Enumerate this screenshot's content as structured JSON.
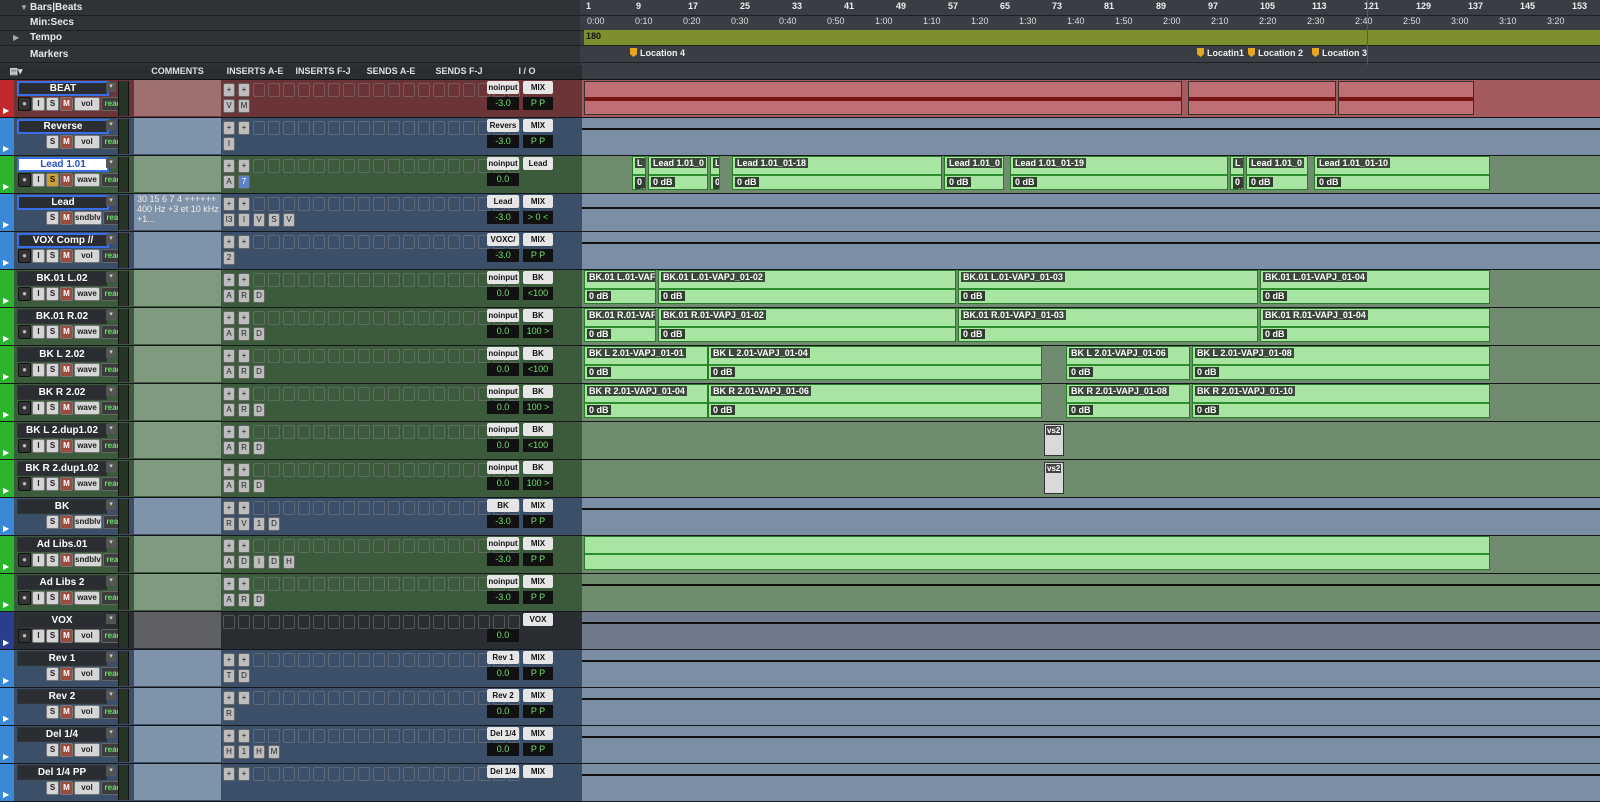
{
  "rulers": {
    "bars_beats_label": "Bars|Beats",
    "minsecs_label": "Min:Secs",
    "tempo_label": "Tempo",
    "markers_label": "Markers",
    "bar_ticks": [
      "1",
      "9",
      "17",
      "25",
      "33",
      "41",
      "49",
      "57",
      "65",
      "73",
      "81",
      "89",
      "97",
      "105",
      "113",
      "121",
      "129",
      "137",
      "145",
      "153"
    ],
    "time_ticks": [
      "0:00",
      "0:10",
      "0:20",
      "0:30",
      "0:40",
      "0:50",
      "1:00",
      "1:10",
      "1:20",
      "1:30",
      "1:40",
      "1:50",
      "2:00",
      "2:10",
      "2:20",
      "2:30",
      "2:40",
      "2:50",
      "3:00",
      "3:10",
      "3:20"
    ],
    "tempo_value": "180",
    "markers": [
      "Location 4",
      "Locatin1",
      "Location 2",
      "Location 3"
    ]
  },
  "columns": {
    "comments": "COMMENTS",
    "inserts_ae": "INSERTS A-E",
    "inserts_fj": "INSERTS F-J",
    "sends_ae": "SENDS A-E",
    "sends_fj": "SENDS F-J",
    "io": "I / O"
  },
  "tracks": [
    {
      "name": "BEAT",
      "color": "#c0282b",
      "vol": "-3.0",
      "pan": "P  P",
      "input": "noinput",
      "output": "MIX",
      "view": "vol",
      "mode": "read",
      "inserts": "V M",
      "comments": ""
    },
    {
      "name": "Reverse",
      "color": "#3a88d6",
      "vol": "-3.0",
      "pan": "P  P",
      "input": "Revers",
      "output": "MIX",
      "view": "vol",
      "mode": "read",
      "inserts": "I",
      "comments": ""
    },
    {
      "name": "Lead 1.01",
      "color": "#2cb52c",
      "vol": "0.0",
      "pan": "",
      "input": "noinput",
      "output": "Lead",
      "view": "wave",
      "mode": "read",
      "inserts": "A 7",
      "comments": ""
    },
    {
      "name": "Lead",
      "color": "#3a88d6",
      "vol": "-3.0",
      "pan": "> 0 <",
      "input": "Lead",
      "output": "MIX",
      "view": "sndblv",
      "mode": "read",
      "inserts": "I3 I V S V",
      "comments": "30 15 6 7 4 ++++++ 400 Hz +3 et 10 kHz +1..."
    },
    {
      "name": "VOX Comp //",
      "color": "#3a88d6",
      "vol": "-3.0",
      "pan": "P  P",
      "input": "VOXC/",
      "output": "MIX",
      "view": "vol",
      "mode": "read",
      "inserts": "2",
      "comments": ""
    },
    {
      "name": "BK.01 L.02",
      "color": "#2cb52c",
      "vol": "0.0",
      "pan": "<100",
      "input": "noinput",
      "output": "BK",
      "view": "wave",
      "mode": "read",
      "inserts": "A R D",
      "comments": ""
    },
    {
      "name": "BK.01 R.02",
      "color": "#2cb52c",
      "vol": "0.0",
      "pan": "100 >",
      "input": "noinput",
      "output": "BK",
      "view": "wave",
      "mode": "read",
      "inserts": "A R D",
      "comments": ""
    },
    {
      "name": "BK L 2.02",
      "color": "#2cb52c",
      "vol": "0.0",
      "pan": "<100",
      "input": "noinput",
      "output": "BK",
      "view": "wave",
      "mode": "read",
      "inserts": "A R D",
      "comments": ""
    },
    {
      "name": "BK R 2.02",
      "color": "#2cb52c",
      "vol": "0.0",
      "pan": "100 >",
      "input": "noinput",
      "output": "BK",
      "view": "wave",
      "mode": "read",
      "inserts": "A R D",
      "comments": ""
    },
    {
      "name": "BK L 2.dup1.02",
      "color": "#2cb52c",
      "vol": "0.0",
      "pan": "<100",
      "input": "noinput",
      "output": "BK",
      "view": "wave",
      "mode": "read",
      "inserts": "A R D",
      "comments": ""
    },
    {
      "name": "BK R 2.dup1.02",
      "color": "#2cb52c",
      "vol": "0.0",
      "pan": "100 >",
      "input": "noinput",
      "output": "BK",
      "view": "wave",
      "mode": "read",
      "inserts": "A R D",
      "comments": ""
    },
    {
      "name": "BK",
      "color": "#3a88d6",
      "vol": "-3.0",
      "pan": "P  P",
      "input": "BK",
      "output": "MIX",
      "view": "sndblv",
      "mode": "read",
      "inserts": "R V 1 D",
      "comments": ""
    },
    {
      "name": "Ad Libs.01",
      "color": "#2cb52c",
      "vol": "-3.0",
      "pan": "P  P",
      "input": "noinput",
      "output": "MIX",
      "view": "sndblv",
      "mode": "read",
      "inserts": "A D I D H",
      "comments": ""
    },
    {
      "name": "Ad Libs 2",
      "color": "#2cb52c",
      "vol": "-3.0",
      "pan": "P  P",
      "input": "noinput",
      "output": "MIX",
      "view": "wave",
      "mode": "read",
      "inserts": "A R D",
      "comments": ""
    },
    {
      "name": "VOX",
      "color": "#2a3d8f",
      "vol": "0.0",
      "pan": "",
      "input": "",
      "output": "VOX",
      "view": "vol",
      "mode": "read",
      "inserts": "",
      "comments": ""
    },
    {
      "name": "Rev 1",
      "color": "#3a88d6",
      "vol": "0.0",
      "pan": "P  P",
      "input": "Rev 1",
      "output": "MIX",
      "view": "vol",
      "mode": "read",
      "inserts": "T D",
      "comments": ""
    },
    {
      "name": "Rev 2",
      "color": "#3a88d6",
      "vol": "0.0",
      "pan": "P  P",
      "input": "Rev 2",
      "output": "MIX",
      "view": "vol",
      "mode": "read",
      "inserts": "R",
      "comments": ""
    },
    {
      "name": "Del 1/4",
      "color": "#3a88d6",
      "vol": "0.0",
      "pan": "P  P",
      "input": "Del 1/4",
      "output": "MIX",
      "view": "vol",
      "mode": "read",
      "inserts": "H 1 H M",
      "comments": ""
    },
    {
      "name": "Del 1/4 PP",
      "color": "#3a88d6",
      "vol": "",
      "pan": "",
      "input": "Del 1/4 P",
      "output": "MIX",
      "view": "vol",
      "mode": "read",
      "inserts": "",
      "comments": ""
    }
  ],
  "clips": {
    "lead101": [
      "L",
      "Lead 1.01_0",
      "L",
      "Lead 1.01_01-18",
      "Lead 1.01_0",
      "Lead 1.01_01-19",
      "L",
      "Lead 1.01_0",
      "Lead 1.01_01-10"
    ],
    "bk01l": [
      "BK.01 L.01-VAF",
      "BK.01 L.01-VAPJ_01-02",
      "BK.01 L.01-VAPJ_01-03",
      "BK.01 L.01-VAPJ_01-04"
    ],
    "bk01r": [
      "BK.01 R.01-VAF",
      "BK.01 R.01-VAPJ_01-02",
      "BK.01 R.01-VAPJ_01-03",
      "BK.01 R.01-VAPJ_01-04"
    ],
    "bkl2": [
      "BK L 2.01-VAPJ_01-01",
      "BK L 2.01-VAPJ_01-04",
      "BK L 2.01-VAPJ_01-06",
      "BK L 2.01-VAPJ_01-08"
    ],
    "bkr2": [
      "BK R 2.01-VAPJ_01-04",
      "BK R 2.01-VAPJ_01-06",
      "BK R 2.01-VAPJ_01-08",
      "BK R 2.01-VAPJ_01-10"
    ],
    "vs2": "vs2",
    "gain": "0 dB"
  }
}
